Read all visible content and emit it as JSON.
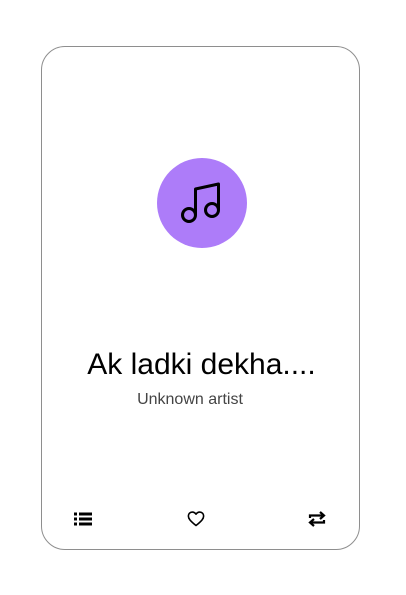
{
  "track": {
    "title": "Ak ladki dekha....",
    "artist": "Unknown artist"
  },
  "icons": {
    "artwork": "music-note-icon",
    "playlist": "playlist-icon",
    "favorite": "heart-outline-icon",
    "repeat": "repeat-icon"
  },
  "colors": {
    "art_background": "#ad7cf9",
    "card_border": "#8e8e8e",
    "title": "#000000",
    "artist": "#444444"
  }
}
